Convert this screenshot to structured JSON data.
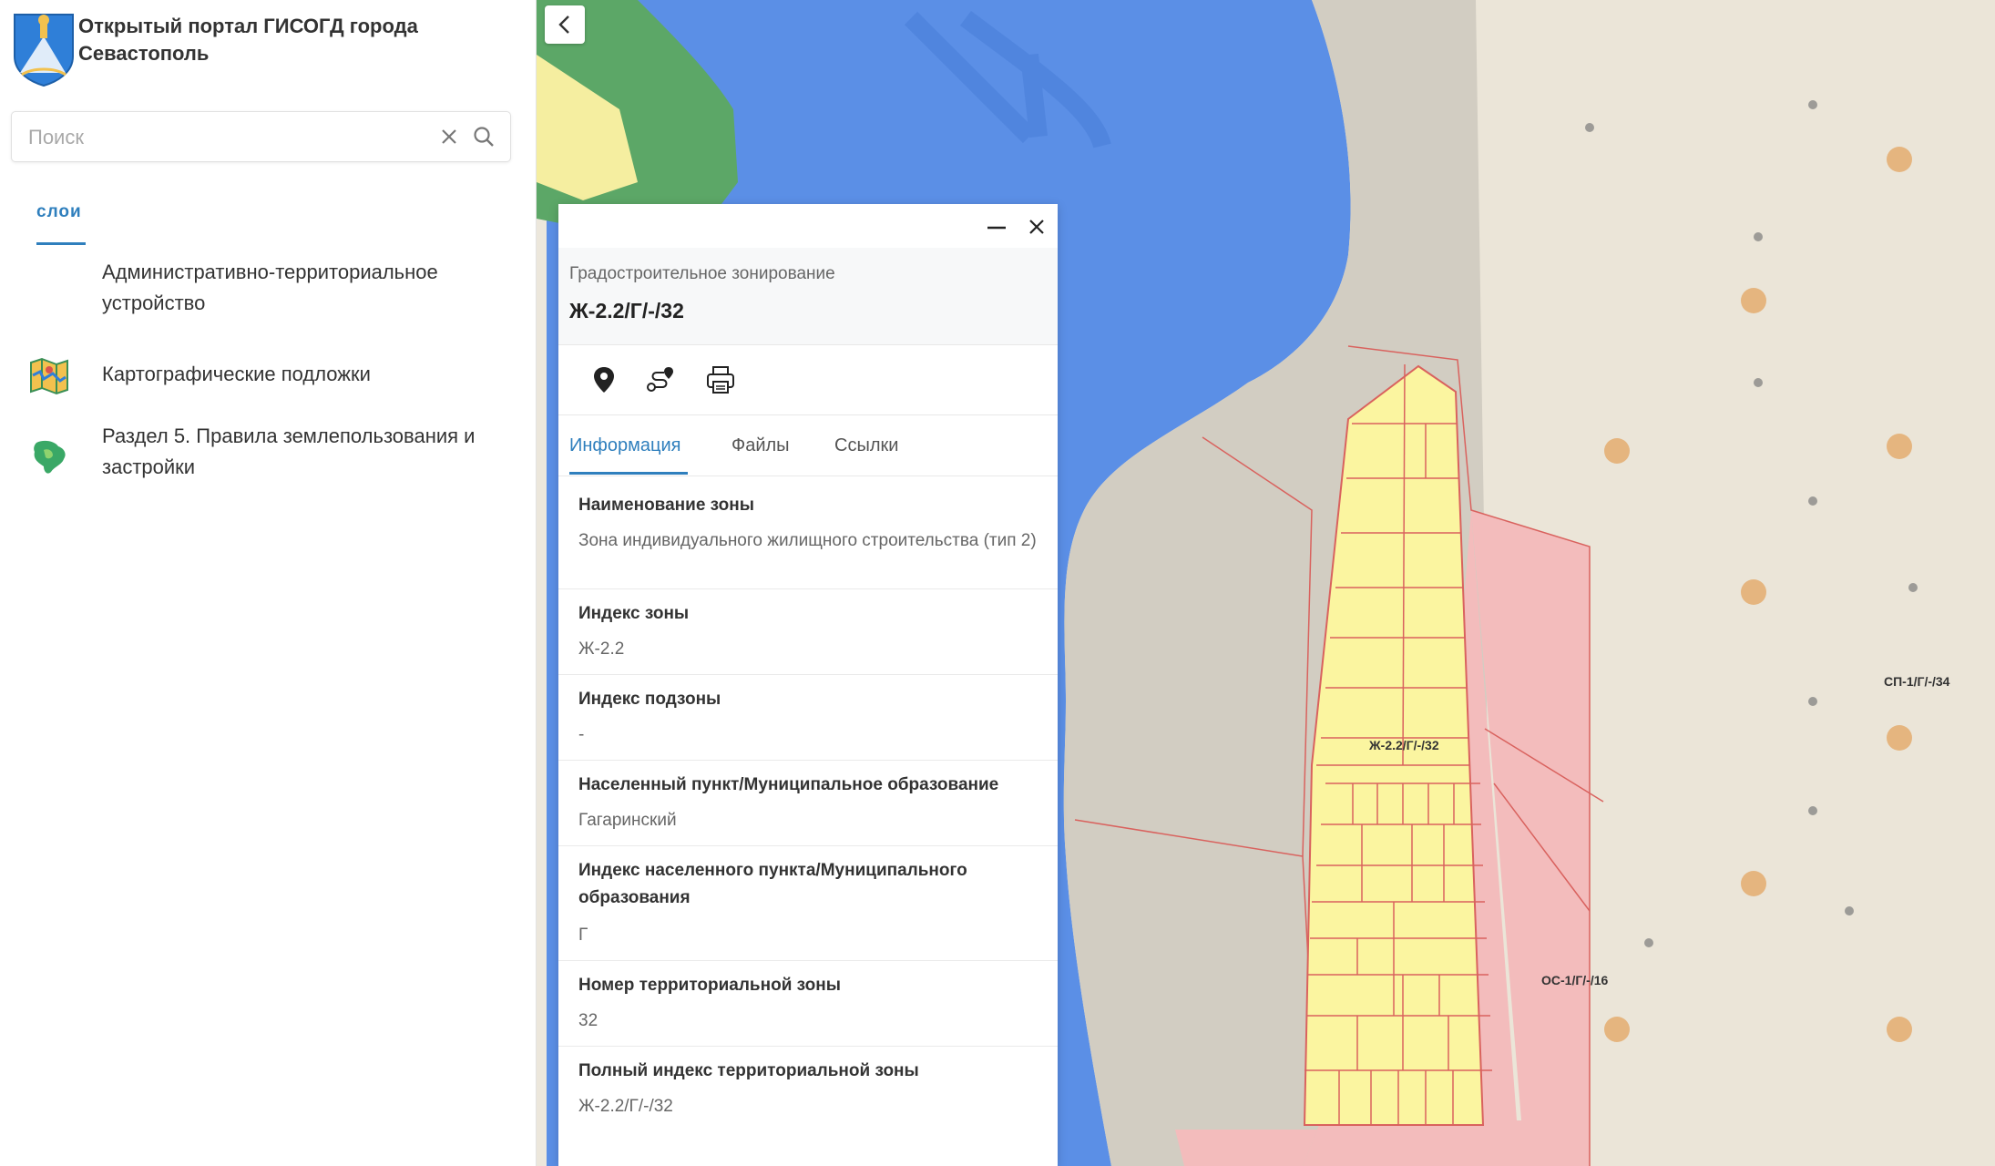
{
  "portal": {
    "title": "Открытый портал ГИСОГД города Севастополь"
  },
  "search": {
    "placeholder": "Поиск",
    "value": ""
  },
  "sidebar": {
    "tab_label": "слои",
    "layers": [
      {
        "label": "Административно-территориальное устройство",
        "icon": "admin-division-icon"
      },
      {
        "label": "Картографические подложки",
        "icon": "map-basemap-icon"
      },
      {
        "label": "Раздел 5. Правила землепользования и застройки",
        "icon": "land-use-icon"
      }
    ]
  },
  "panel": {
    "category": "Градостроительное зонирование",
    "zone_code": "Ж-2.2/Г/-/32",
    "actions": [
      {
        "name": "location-pin-icon"
      },
      {
        "name": "route-icon"
      },
      {
        "name": "print-icon"
      }
    ],
    "tabs": [
      {
        "label": "Информация",
        "active": true
      },
      {
        "label": "Файлы",
        "active": false
      },
      {
        "label": "Ссылки",
        "active": false
      }
    ],
    "fields": [
      {
        "label": "Наименование зоны",
        "value": "Зона индивидуального жилищного строительства (тип 2)"
      },
      {
        "label": "Индекс зоны",
        "value": "Ж-2.2"
      },
      {
        "label": "Индекс подзоны",
        "value": "-"
      },
      {
        "label": "Населенный пункт/Муниципальное образование",
        "value": "Гагаринский"
      },
      {
        "label": "Индекс населенного пункта/Муниципального образования",
        "value": "Г"
      },
      {
        "label": "Номер территориальной зоны",
        "value": "32"
      },
      {
        "label": "Полный индекс территориальной зоны",
        "value": "Ж-2.2/Г/-/32"
      }
    ]
  },
  "map": {
    "labels": [
      {
        "text": "Ж-2.2/Г/-/32"
      },
      {
        "text": "СП-1/Г/-/34"
      },
      {
        "text": "ОС-1/Г/-/16"
      }
    ],
    "colors": {
      "water": "#5b8fe6",
      "land": "#d9d4c9",
      "residential": "#fbf5a0",
      "public_zone": "#f7c1c1",
      "boundary": "#d9625e",
      "forest": "#58a36a"
    }
  },
  "colors": {
    "accent": "#2f7fbd"
  }
}
